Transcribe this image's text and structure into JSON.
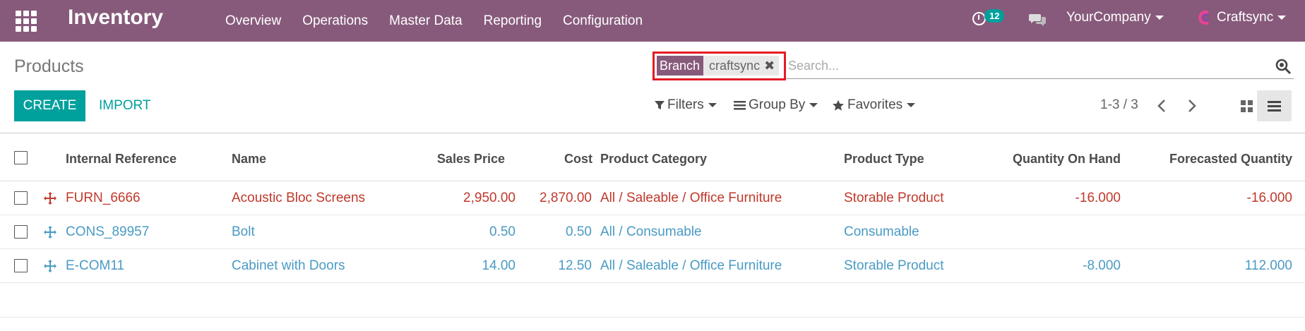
{
  "app": {
    "title": "Inventory",
    "menu": [
      "Overview",
      "Operations",
      "Master Data",
      "Reporting",
      "Configuration"
    ],
    "activity_count": "12",
    "company": "YourCompany",
    "user": "Craftsync"
  },
  "control_panel": {
    "breadcrumb": "Products",
    "facet": {
      "label": "Branch",
      "value": "craftsync",
      "remove": "✖"
    },
    "search_placeholder": "Search...",
    "create_label": "CREATE",
    "import_label": "IMPORT",
    "filters_label": "Filters",
    "groupby_label": "Group By",
    "favorites_label": "Favorites",
    "pager": "1-3 / 3"
  },
  "table": {
    "columns": [
      "Internal Reference",
      "Name",
      "Sales Price",
      "Cost",
      "Product Category",
      "Product Type",
      "Quantity On Hand",
      "Forecasted Quantity"
    ],
    "rows": [
      {
        "ref": "FURN_6666",
        "name": "Acoustic Bloc Screens",
        "price": "2,950.00",
        "cost": "2,870.00",
        "category": "All / Saleable / Office Furniture",
        "type": "Storable Product",
        "on_hand": "-16.000",
        "forecast": "-16.000",
        "style": "red"
      },
      {
        "ref": "CONS_89957",
        "name": "Bolt",
        "price": "0.50",
        "cost": "0.50",
        "category": "All / Consumable",
        "type": "Consumable",
        "on_hand": "",
        "forecast": "",
        "style": "blue"
      },
      {
        "ref": "E-COM11",
        "name": "Cabinet with Doors",
        "price": "14.00",
        "cost": "12.50",
        "category": "All / Saleable / Office Furniture",
        "type": "Storable Product",
        "on_hand": "-8.000",
        "forecast": "112.000",
        "style": "blue"
      }
    ]
  },
  "colors": {
    "navbar": "#875a7b",
    "accent": "#00a09d",
    "danger_row": "#c0392b",
    "info_row": "#4a9ac4",
    "highlight_box": "#e31b23"
  },
  "icons": [
    "apps-grid-icon",
    "clock-icon",
    "chat-icon",
    "search-icon",
    "filter-icon",
    "bars-icon",
    "star-icon",
    "chevron-left-icon",
    "chevron-right-icon",
    "kanban-view-icon",
    "list-view-icon",
    "drag-handle-icon"
  ]
}
